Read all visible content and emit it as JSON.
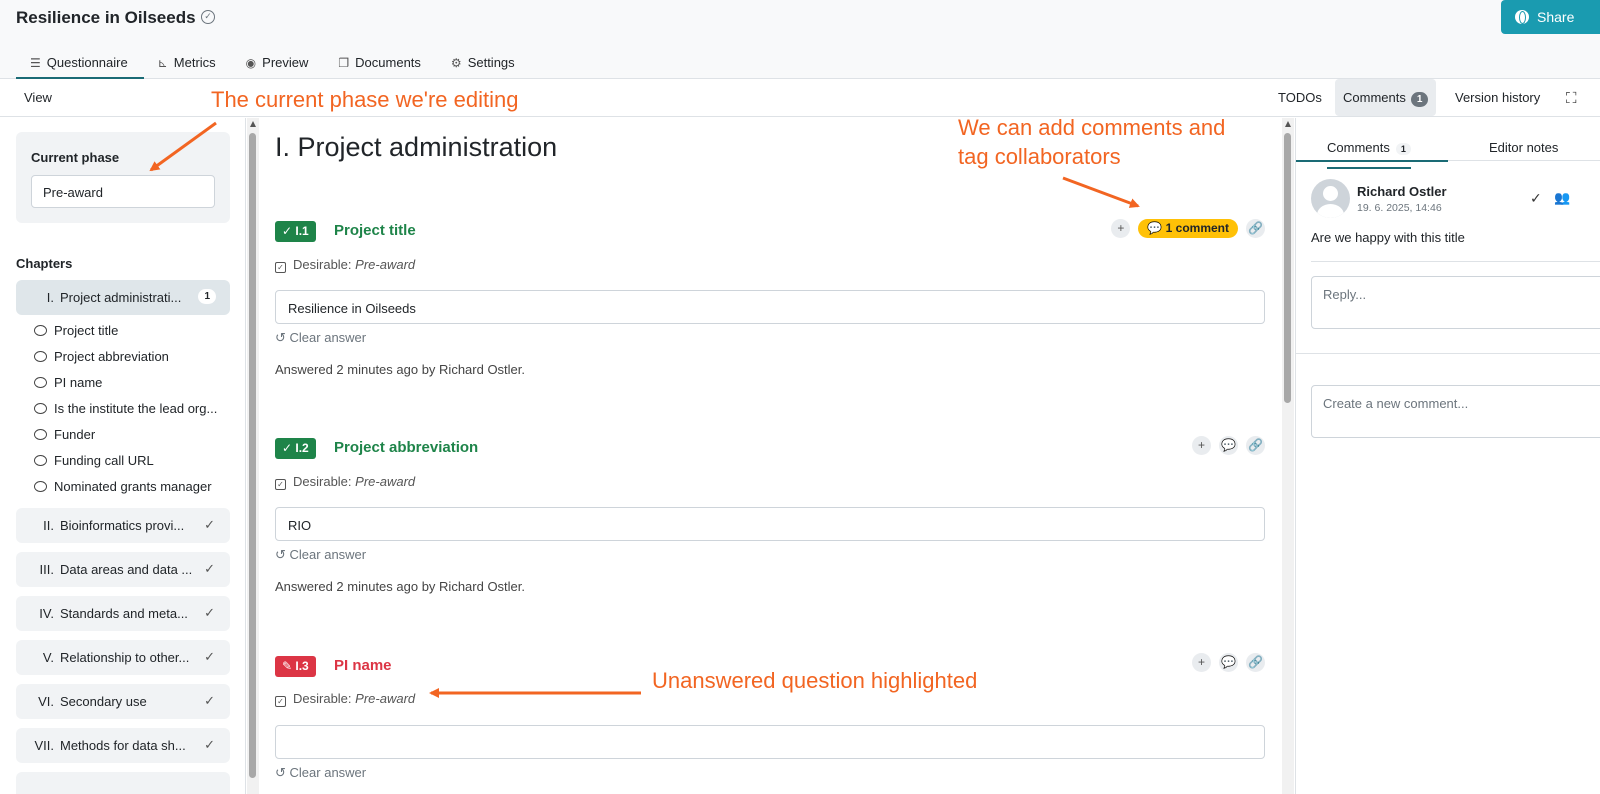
{
  "header": {
    "title": "Resilience in Oilseeds",
    "share_label": "Share",
    "tabs": [
      {
        "label": "Questionnaire",
        "icon": "list-icon"
      },
      {
        "label": "Metrics",
        "icon": "chart-icon"
      },
      {
        "label": "Preview",
        "icon": "eye-icon"
      },
      {
        "label": "Documents",
        "icon": "copy-icon"
      },
      {
        "label": "Settings",
        "icon": "gears-icon"
      }
    ]
  },
  "viewbar": {
    "view_label": "View",
    "todos": "TODOs",
    "comments": "Comments",
    "comments_count": "1",
    "version_history": "Version history"
  },
  "sidebar": {
    "phase_label": "Current phase",
    "phase_value": "Pre-award",
    "chapters_heading": "Chapters",
    "chapters": [
      {
        "num": "I.",
        "label": "Project administrati...",
        "badge": "1"
      },
      {
        "num": "II.",
        "label": "Bioinformatics provi..."
      },
      {
        "num": "III.",
        "label": "Data areas and data ..."
      },
      {
        "num": "IV.",
        "label": "Standards and meta..."
      },
      {
        "num": "V.",
        "label": "Relationship to other..."
      },
      {
        "num": "VI.",
        "label": "Secondary use"
      },
      {
        "num": "VII.",
        "label": "Methods for data sh..."
      }
    ],
    "questions": [
      "Project title",
      "Project abbreviation",
      "PI name",
      "Is the institute the lead org...",
      "Funder",
      "Funding call URL",
      "Nominated grants manager"
    ]
  },
  "main": {
    "chapter_title": "I. Project administration",
    "questions": [
      {
        "tag": "I.1",
        "title": "Project title",
        "desirable_label": "Desirable:",
        "desirable_phase": "Pre-award",
        "answer": "Resilience in Oilseeds",
        "clear_label": "Clear answer",
        "answered_text": "Answered 2 minutes ago by Richard Ostler.",
        "comment_badge": "1 comment"
      },
      {
        "tag": "I.2",
        "title": "Project abbreviation",
        "desirable_label": "Desirable:",
        "desirable_phase": "Pre-award",
        "answer": "RIO",
        "clear_label": "Clear answer",
        "answered_text": "Answered 2 minutes ago by Richard Ostler."
      },
      {
        "tag": "I.3",
        "title": "PI name",
        "desirable_label": "Desirable:",
        "desirable_phase": "Pre-award",
        "answer": "",
        "clear_label": "Clear answer"
      }
    ]
  },
  "right_panel": {
    "tab_comments": "Comments",
    "tab_comments_count": "1",
    "tab_editor_notes": "Editor notes",
    "comment": {
      "author": "Richard Ostler",
      "time": "19. 6. 2025, 14:46",
      "text": "Are we happy with this title"
    },
    "reply_placeholder": "Reply...",
    "new_comment_placeholder": "Create a new comment..."
  },
  "annotations": {
    "phase_note": "The current phase we're editing",
    "comments_note_line1": "We can add comments and",
    "comments_note_line2": "tag collaborators",
    "unanswered_note": "Unanswered question highlighted"
  },
  "colors": {
    "accent": "#1a9bb0",
    "answered_green": "#1e8449",
    "unanswered_red": "#dc3545",
    "comment_yellow": "#ffc107",
    "annotation_orange": "#f26522"
  }
}
